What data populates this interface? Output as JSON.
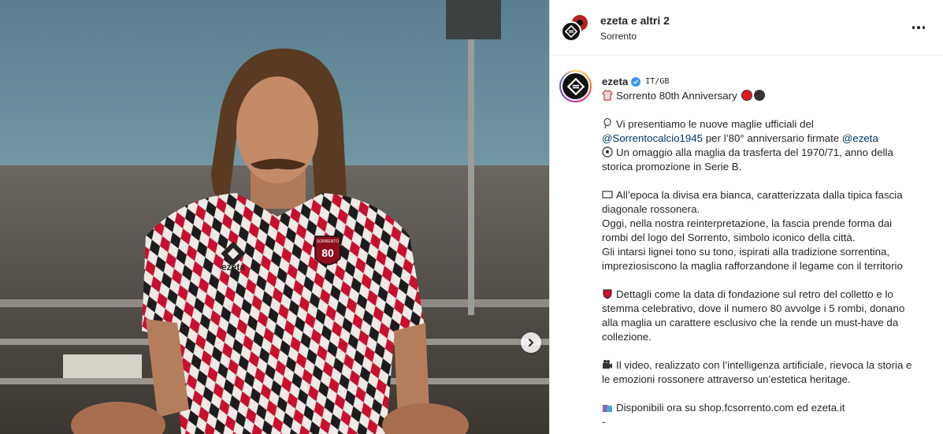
{
  "media": {
    "carousel_next_label": "›"
  },
  "header": {
    "title": "ezeta e altri 2",
    "location": "Sorrento",
    "more_label": "More options"
  },
  "caption": {
    "username": "ezeta",
    "lang": "IT/GB",
    "lines": [
      "Sorrento 80th Anniversary",
      "",
      "Vi presentiamo le nuove maglie ufficiali del",
      "per l’80° anniversario firmate",
      "Un omaggio alla maglia da trasferta del 1970/71, anno della",
      "storica promozione in Serie B.",
      "",
      "All’epoca la divisa era bianca, caratterizzata dalla tipica fascia",
      "diagonale rossonera.",
      "Oggi, nella nostra reinterpretazione, la fascia prende forma dai",
      "rombi del logo del Sorrento, simbolo iconico della città.",
      "Gli intarsi lignei tono su tono, ispirati alla tradizione sorrentina,",
      "impreziosiscono la maglia rafforzandone il legame con il territorio",
      "",
      "Dettagli come la data di fondazione sul retro del colletto e lo",
      "stemma celebrativo, dove il numero 80 avvolge i 5 rombi, donano",
      "alla maglia un carattere esclusivo che la rende un must-have da",
      "collezione.",
      "",
      "Il video, realizzato con l’intelligenza artificiale, rievoca la storia e",
      "le emozioni rossonere attraverso un’estetica heritage.",
      "",
      "Disponibili ora su shop.fcsorrento.com ed ezeta.it",
      "-"
    ],
    "mentions": {
      "club": "@Sorrentocalcio1945",
      "brand": "@ezeta"
    }
  },
  "colors": {
    "accent_link": "#00376b",
    "verified": "#3897f0",
    "dot_red": "#e0191e",
    "dot_black": "#333333"
  },
  "jersey": {
    "brand": "ezeta",
    "crest_name": "SORRENTO",
    "crest_number": "80"
  }
}
